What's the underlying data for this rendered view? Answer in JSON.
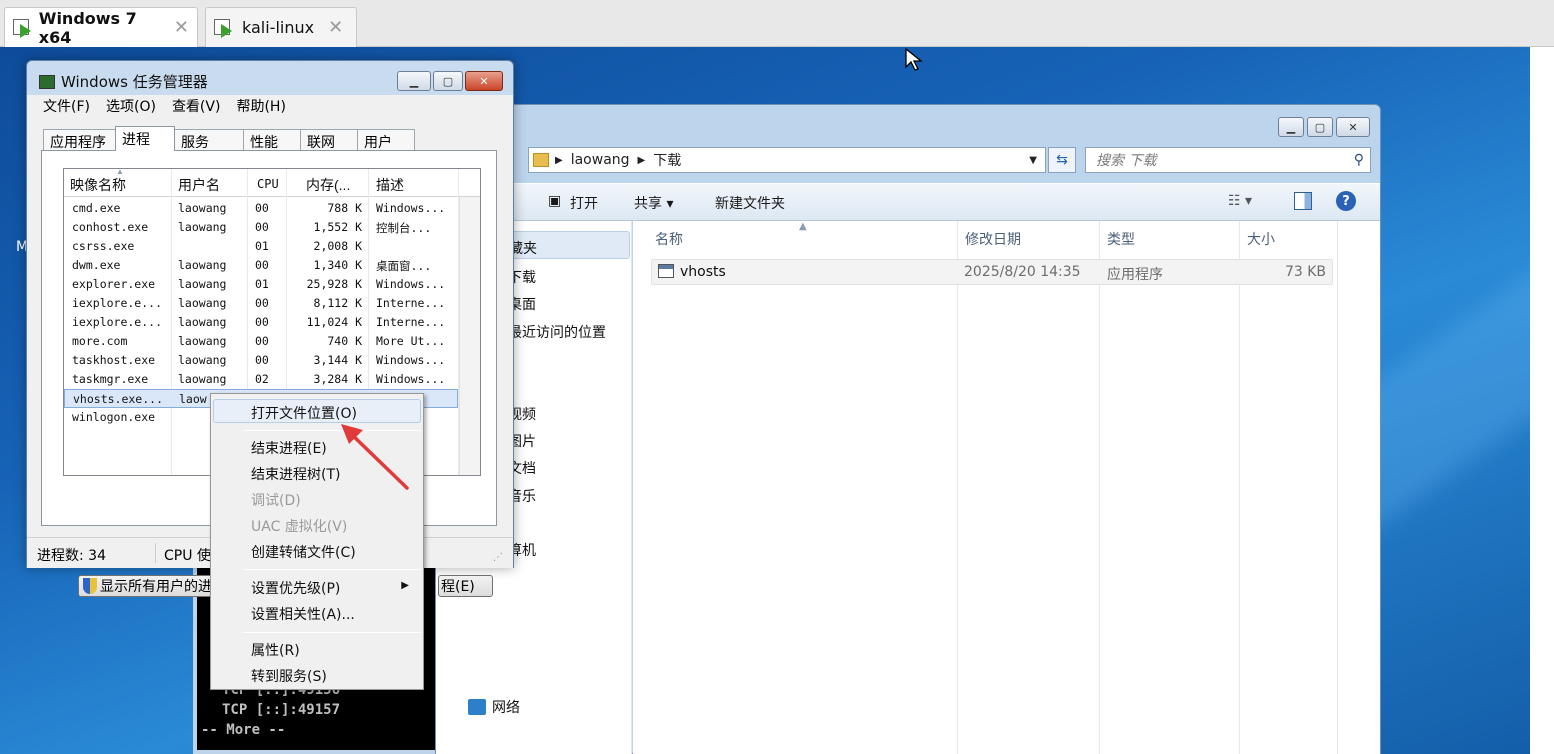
{
  "vm_tabs": [
    {
      "label": "Windows 7 x64",
      "close": "✕"
    },
    {
      "label": "kali-linux",
      "close": "✕"
    }
  ],
  "desktop": {
    "left_edge_char": "M"
  },
  "cmd": {
    "line1": "TCP    [::]:49156",
    "line2": "TCP    [::]:49157",
    "line3": "-- More  --"
  },
  "explorer": {
    "breadcrumb": [
      "laowang",
      "下载"
    ],
    "search_placeholder": "搜索 下载",
    "toolbar": {
      "open": "打开",
      "share": "共享 ▾",
      "new_folder": "新建文件夹"
    },
    "nav_pane": {
      "favorites": "藏夹",
      "downloads": "下载",
      "desktop": "桌面",
      "recent": "最近访问的位置",
      "videos": "视频",
      "pictures": "图片",
      "documents": "文档",
      "music": "音乐",
      "computer": "算机",
      "network": "网络"
    },
    "columns": {
      "name": "名称",
      "modified": "修改日期",
      "type": "类型",
      "size": "大小"
    },
    "files": [
      {
        "name": "vhosts",
        "modified": "2025/8/20 14:35",
        "type": "应用程序",
        "size": "73 KB"
      }
    ]
  },
  "taskmgr": {
    "title": "Windows 任务管理器",
    "menu": [
      "文件(F)",
      "选项(O)",
      "查看(V)",
      "帮助(H)"
    ],
    "tabs": [
      "应用程序",
      "进程",
      "服务",
      "性能",
      "联网",
      "用户"
    ],
    "active_tab": "进程",
    "columns": {
      "image": "映像名称",
      "user": "用户名",
      "cpu": "CPU",
      "mem": "内存(...",
      "desc": "描述"
    },
    "processes": [
      {
        "image": "cmd.exe",
        "user": "laowang",
        "cpu": "00",
        "mem": "788 K",
        "desc": "Windows..."
      },
      {
        "image": "conhost.exe",
        "user": "laowang",
        "cpu": "00",
        "mem": "1,552 K",
        "desc": "控制台..."
      },
      {
        "image": "csrss.exe",
        "user": "",
        "cpu": "01",
        "mem": "2,008 K",
        "desc": ""
      },
      {
        "image": "dwm.exe",
        "user": "laowang",
        "cpu": "00",
        "mem": "1,340 K",
        "desc": "桌面窗..."
      },
      {
        "image": "explorer.exe",
        "user": "laowang",
        "cpu": "01",
        "mem": "25,928 K",
        "desc": "Windows..."
      },
      {
        "image": "iexplore.e...",
        "user": "laowang",
        "cpu": "00",
        "mem": "8,112 K",
        "desc": "Interne..."
      },
      {
        "image": "iexplore.e...",
        "user": "laowang",
        "cpu": "00",
        "mem": "11,024 K",
        "desc": "Interne..."
      },
      {
        "image": "more.com",
        "user": "laowang",
        "cpu": "00",
        "mem": "740 K",
        "desc": "More Ut..."
      },
      {
        "image": "taskhost.exe",
        "user": "laowang",
        "cpu": "00",
        "mem": "3,144 K",
        "desc": "Windows..."
      },
      {
        "image": "taskmgr.exe",
        "user": "laowang",
        "cpu": "02",
        "mem": "3,284 K",
        "desc": "Windows..."
      },
      {
        "image": "vhosts.exe...",
        "user": "laow",
        "cpu": "",
        "mem": "",
        "desc": ""
      },
      {
        "image": "winlogon.exe",
        "user": "",
        "cpu": "",
        "mem": "",
        "desc": ""
      }
    ],
    "show_all_button": "显示所有用户的进",
    "end_process_button": "程(E)",
    "status": {
      "process_count": "进程数: 34",
      "cpu": "CPU 使"
    }
  },
  "context_menu": {
    "items": [
      {
        "label": "打开文件位置(O)",
        "disabled": false
      },
      {
        "label": "结束进程(E)",
        "disabled": false
      },
      {
        "label": "结束进程树(T)",
        "disabled": false
      },
      {
        "label": "调试(D)",
        "disabled": true
      },
      {
        "label": "UAC 虚拟化(V)",
        "disabled": true
      },
      {
        "label": "创建转储文件(C)",
        "disabled": false
      },
      {
        "label": "设置优先级(P)",
        "disabled": false
      },
      {
        "label": "设置相关性(A)...",
        "disabled": false
      },
      {
        "label": "属性(R)",
        "disabled": false
      },
      {
        "label": "转到服务(S)",
        "disabled": false
      }
    ]
  },
  "colors": {
    "annotation_arrow": "#e03a3a",
    "desktop_blue": "#1d6fb6"
  }
}
